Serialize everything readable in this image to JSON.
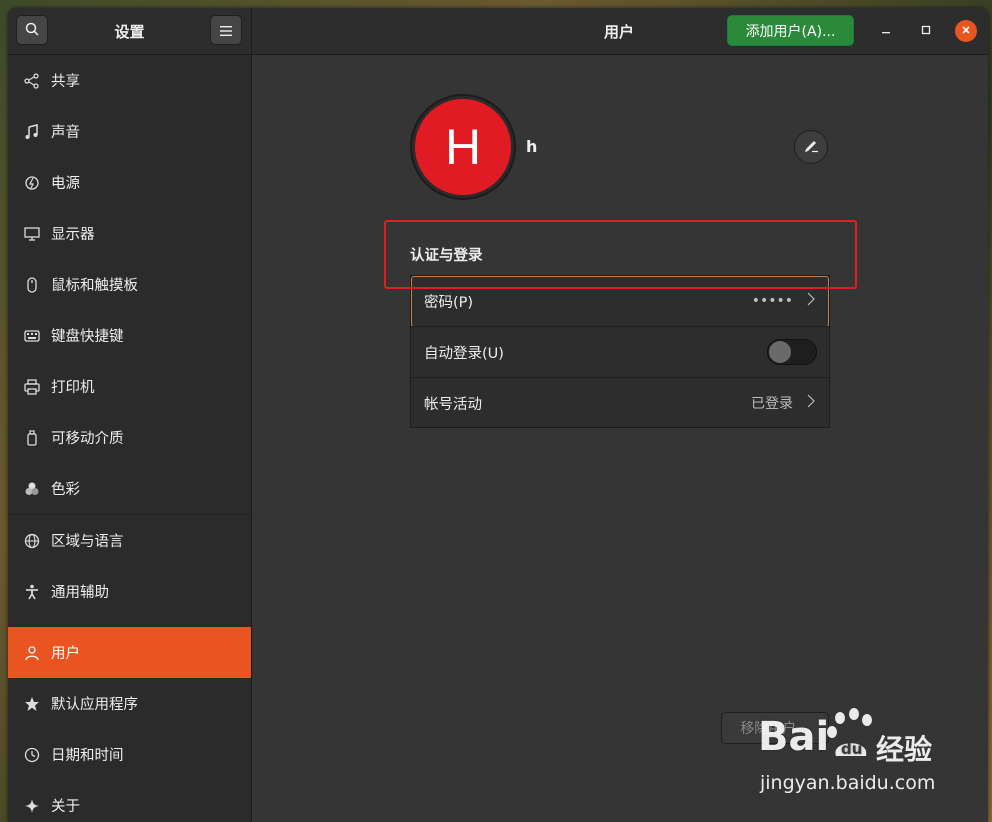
{
  "window": {
    "settings_title": "设置",
    "panel_title": "用户",
    "add_user_label": "添加用户(A)...",
    "controls": {
      "minimize": "–",
      "maximize": "□",
      "close": "×"
    }
  },
  "sidebar": {
    "items": [
      {
        "label": "共享",
        "icon": "share-icon"
      },
      {
        "label": "声音",
        "icon": "music-note-icon"
      },
      {
        "label": "电源",
        "icon": "power-icon"
      },
      {
        "label": "显示器",
        "icon": "display-icon"
      },
      {
        "label": "鼠标和触摸板",
        "icon": "mouse-icon"
      },
      {
        "label": "键盘快捷键",
        "icon": "keyboard-icon"
      },
      {
        "label": "打印机",
        "icon": "printer-icon"
      },
      {
        "label": "可移动介质",
        "icon": "usb-drive-icon"
      },
      {
        "label": "色彩",
        "icon": "color-icon"
      },
      {
        "label": "区域与语言",
        "icon": "globe-icon"
      },
      {
        "label": "通用辅助",
        "icon": "accessibility-icon"
      },
      {
        "label": "用户",
        "icon": "users-icon",
        "active": true
      },
      {
        "label": "默认应用程序",
        "icon": "star-icon"
      },
      {
        "label": "日期和时间",
        "icon": "clock-icon"
      },
      {
        "label": "关于",
        "icon": "sparkle-icon"
      }
    ]
  },
  "user": {
    "avatar_letter": "H",
    "name": "h",
    "avatar_color": "#e01b24"
  },
  "auth": {
    "section_title": "认证与登录",
    "password_label": "密码(P)",
    "password_value": "•••••",
    "autologin_label": "自动登录(U)",
    "autologin_on": false,
    "activity_label": "帐号活动",
    "activity_value": "已登录"
  },
  "remove_user_label": "移除用户...",
  "watermark": {
    "logo": "Bai du",
    "cn": "经验",
    "url": "jingyan.baidu.com"
  },
  "colors": {
    "accent": "#e95420",
    "add_button": "#2a8a3a",
    "highlight": "#e02020"
  }
}
